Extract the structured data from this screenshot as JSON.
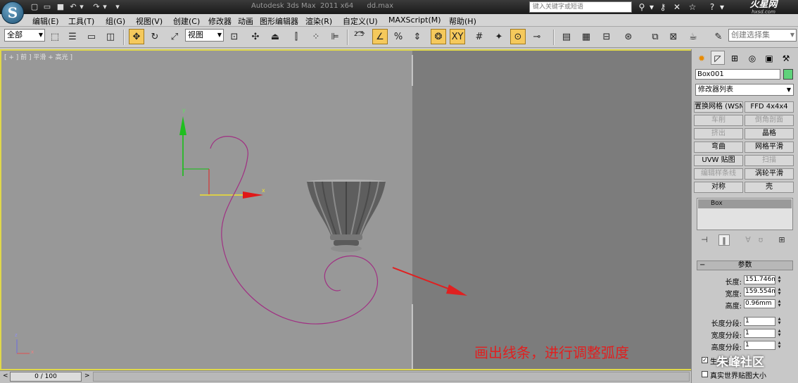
{
  "titlebar": {
    "title": "Autodesk 3ds Max  2011 x64      dd.max",
    "search_placeholder": "键入关键字或短语",
    "app_logo": "S",
    "brand": "火星网",
    "brand_sub": "hxsd.com"
  },
  "menu": [
    "编辑(E)",
    "工具(T)",
    "组(G)",
    "视图(V)",
    "创建(C)",
    "修改器",
    "动画",
    "图形编辑器",
    "渲染(R)",
    "自定义(U)",
    "MAXScript(M)",
    "帮助(H)"
  ],
  "toolbar": {
    "selection_filter": "全部",
    "ref_coord": "视图",
    "snap_angle_label": "2.5",
    "percent_label": "%",
    "xy_label": "XY",
    "named_selection": "创建选择集"
  },
  "viewport": {
    "label": "[ + ] 前 ] 平滑 + 高光 ]",
    "gizmo_y_label": "y",
    "gizmo_x_label": "x",
    "axis_z_label": "z",
    "axis_x_label": "x",
    "annotation": "画出线条，进行调整弧度"
  },
  "command_panel": {
    "object_name": "Box001",
    "object_color": "#5fd27a",
    "modifier_list": "修改器列表",
    "modifier_buttons": [
      {
        "label": "置换网格 (WSM)",
        "enabled": true
      },
      {
        "label": "FFD 4x4x4",
        "enabled": true
      },
      {
        "label": "车削",
        "enabled": false
      },
      {
        "label": "倒角剖面",
        "enabled": false
      },
      {
        "label": "挤出",
        "enabled": false
      },
      {
        "label": "晶格",
        "enabled": true
      },
      {
        "label": "弯曲",
        "enabled": true
      },
      {
        "label": "网格平滑",
        "enabled": true
      },
      {
        "label": "UVW 贴图",
        "enabled": true
      },
      {
        "label": "扫描",
        "enabled": false
      },
      {
        "label": "编辑样条线",
        "enabled": false
      },
      {
        "label": "涡轮平滑",
        "enabled": true
      },
      {
        "label": "对称",
        "enabled": true
      },
      {
        "label": "壳",
        "enabled": true
      }
    ],
    "stack_item": "Box",
    "rollout_title": "参数",
    "params": [
      {
        "label": "长度:",
        "value": "151.746m"
      },
      {
        "label": "宽度:",
        "value": "159.554m"
      },
      {
        "label": "高度:",
        "value": "0.96mm"
      },
      {
        "label": "长度分段:",
        "value": "1"
      },
      {
        "label": "宽度分段:",
        "value": "1"
      },
      {
        "label": "高度分段:",
        "value": "1"
      }
    ],
    "check1_label": "生成贴图",
    "check2_label": "真实世界贴图大小",
    "watermark": "朱峰社区"
  },
  "timeline": {
    "position": "0 / 100"
  }
}
